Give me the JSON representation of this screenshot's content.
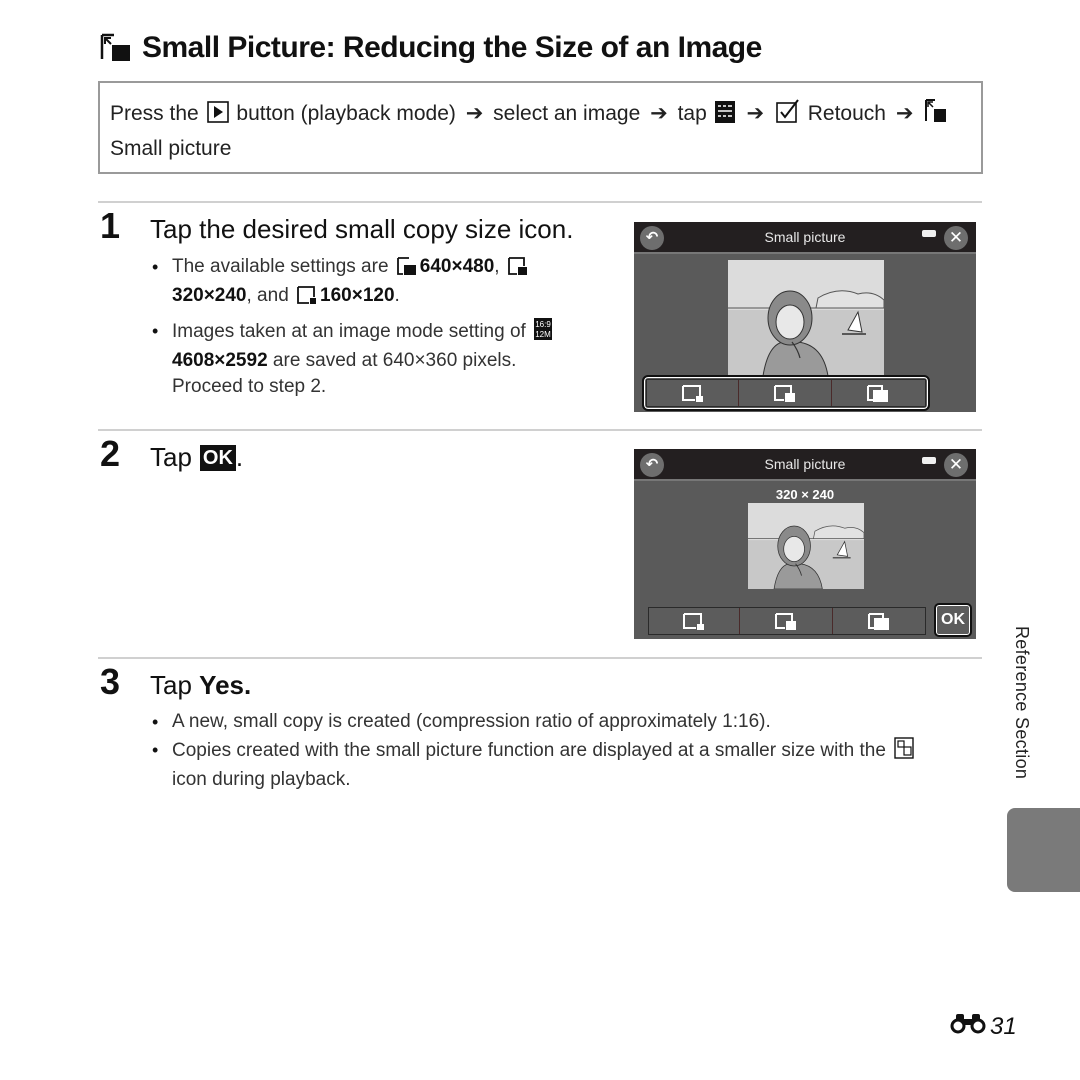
{
  "page": {
    "title": "Small Picture: Reducing the Size of an Image",
    "title_icon": "small-picture-icon"
  },
  "path": {
    "p1": "Press the",
    "playback_icon": "playback-button-icon",
    "p2": "button (playback mode)",
    "p3": "select an image",
    "p4": "tap",
    "menu_icon": "menu-icon",
    "retouch_icon": "retouch-icon",
    "p5": "Retouch",
    "small_icon": "small-picture-icon",
    "p6": "Small picture",
    "arrow": "➔"
  },
  "steps": [
    {
      "number": "1",
      "title": "Tap the desired small copy size icon.",
      "bullets": {
        "b1_a": "The available settings are",
        "s1": "640×480",
        "s2": "320×240",
        "b1_and": ", and",
        "s3": "160×120",
        "b2_a": "Images taken at an image mode setting of",
        "b2_mode": "4608×2592",
        "b2_b": "are saved at 640×360 pixels. Proceed to step 2."
      }
    },
    {
      "number": "2",
      "title_a": "Tap",
      "title_ok": "OK",
      "title_b": "."
    },
    {
      "number": "3",
      "title_a": "Tap",
      "title_bold": "Yes.",
      "bullets": {
        "b1": "A new, small copy is created (compression ratio of approximately 1:16).",
        "b2_a": "Copies created with the small picture function are displayed at a smaller size with the",
        "b2_b": "icon during playback."
      }
    }
  ],
  "screens": [
    {
      "title": "Small picture",
      "back_label": "↶",
      "close_label": "✕",
      "size_label": "",
      "options": [
        "160x120",
        "320x240",
        "640x480"
      ]
    },
    {
      "title": "Small picture",
      "back_label": "↶",
      "close_label": "✕",
      "size_label": "320 × 240",
      "options": [
        "160x120",
        "320x240",
        "640x480"
      ],
      "ok_label": "OK"
    }
  ],
  "sidebar": {
    "section_label": "Reference Section"
  },
  "footer": {
    "page_icon": "binoculars-icon",
    "page_number": "31"
  }
}
